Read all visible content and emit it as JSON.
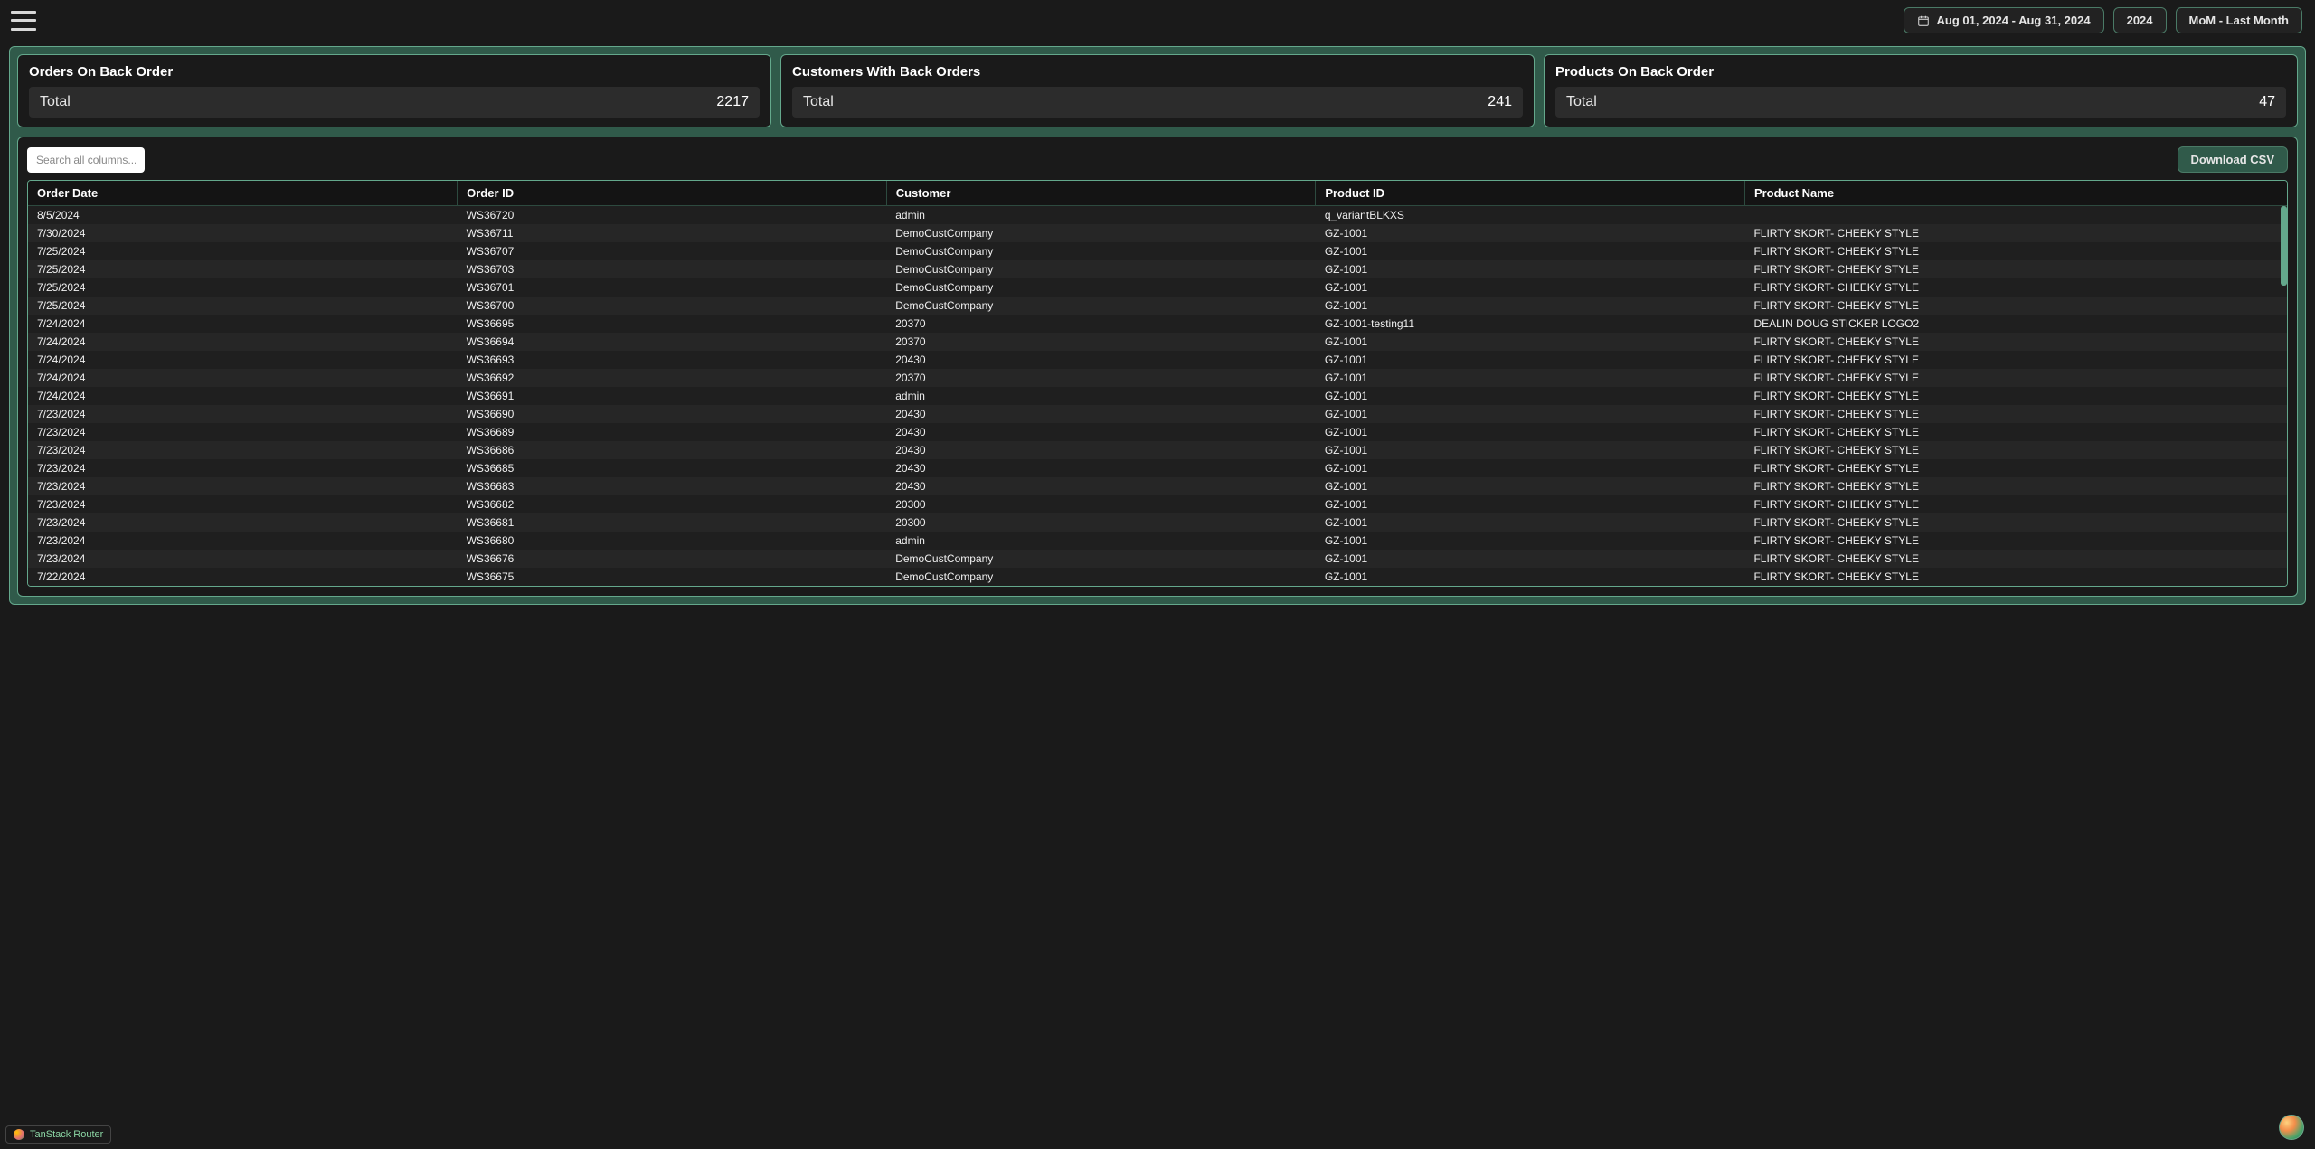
{
  "header": {
    "date_range": "Aug 01, 2024 - Aug 31, 2024",
    "year": "2024",
    "comparison": "MoM - Last Month"
  },
  "cards": [
    {
      "title": "Orders On Back Order",
      "label": "Total",
      "value": "2217"
    },
    {
      "title": "Customers With Back Orders",
      "label": "Total",
      "value": "241"
    },
    {
      "title": "Products On Back Order",
      "label": "Total",
      "value": "47"
    }
  ],
  "table": {
    "search_placeholder": "Search all columns...",
    "download_csv": "Download CSV",
    "columns": [
      "Order Date",
      "Order ID",
      "Customer",
      "Product ID",
      "Product Name"
    ],
    "rows": [
      [
        "8/5/2024",
        "WS36720",
        "admin",
        "q_variantBLKXS",
        ""
      ],
      [
        "7/30/2024",
        "WS36711",
        "DemoCustCompany",
        "GZ-1001",
        "FLIRTY SKORT- CHEEKY STYLE"
      ],
      [
        "7/25/2024",
        "WS36707",
        "DemoCustCompany",
        "GZ-1001",
        "FLIRTY SKORT- CHEEKY STYLE"
      ],
      [
        "7/25/2024",
        "WS36703",
        "DemoCustCompany",
        "GZ-1001",
        "FLIRTY SKORT- CHEEKY STYLE"
      ],
      [
        "7/25/2024",
        "WS36701",
        "DemoCustCompany",
        "GZ-1001",
        "FLIRTY SKORT- CHEEKY STYLE"
      ],
      [
        "7/25/2024",
        "WS36700",
        "DemoCustCompany",
        "GZ-1001",
        "FLIRTY SKORT- CHEEKY STYLE"
      ],
      [
        "7/24/2024",
        "WS36695",
        "20370",
        "GZ-1001-testing11",
        "DEALIN DOUG STICKER LOGO2"
      ],
      [
        "7/24/2024",
        "WS36694",
        "20370",
        "GZ-1001",
        "FLIRTY SKORT- CHEEKY STYLE"
      ],
      [
        "7/24/2024",
        "WS36693",
        "20430",
        "GZ-1001",
        "FLIRTY SKORT- CHEEKY STYLE"
      ],
      [
        "7/24/2024",
        "WS36692",
        "20370",
        "GZ-1001",
        "FLIRTY SKORT- CHEEKY STYLE"
      ],
      [
        "7/24/2024",
        "WS36691",
        "admin",
        "GZ-1001",
        "FLIRTY SKORT- CHEEKY STYLE"
      ],
      [
        "7/23/2024",
        "WS36690",
        "20430",
        "GZ-1001",
        "FLIRTY SKORT- CHEEKY STYLE"
      ],
      [
        "7/23/2024",
        "WS36689",
        "20430",
        "GZ-1001",
        "FLIRTY SKORT- CHEEKY STYLE"
      ],
      [
        "7/23/2024",
        "WS36686",
        "20430",
        "GZ-1001",
        "FLIRTY SKORT- CHEEKY STYLE"
      ],
      [
        "7/23/2024",
        "WS36685",
        "20430",
        "GZ-1001",
        "FLIRTY SKORT- CHEEKY STYLE"
      ],
      [
        "7/23/2024",
        "WS36683",
        "20430",
        "GZ-1001",
        "FLIRTY SKORT- CHEEKY STYLE"
      ],
      [
        "7/23/2024",
        "WS36682",
        "20300",
        "GZ-1001",
        "FLIRTY SKORT- CHEEKY STYLE"
      ],
      [
        "7/23/2024",
        "WS36681",
        "20300",
        "GZ-1001",
        "FLIRTY SKORT- CHEEKY STYLE"
      ],
      [
        "7/23/2024",
        "WS36680",
        "admin",
        "GZ-1001",
        "FLIRTY SKORT- CHEEKY STYLE"
      ],
      [
        "7/23/2024",
        "WS36676",
        "DemoCustCompany",
        "GZ-1001",
        "FLIRTY SKORT- CHEEKY STYLE"
      ],
      [
        "7/22/2024",
        "WS36675",
        "DemoCustCompany",
        "GZ-1001",
        "FLIRTY SKORT- CHEEKY STYLE"
      ]
    ]
  },
  "footer": {
    "router_label": "TanStack Router"
  }
}
